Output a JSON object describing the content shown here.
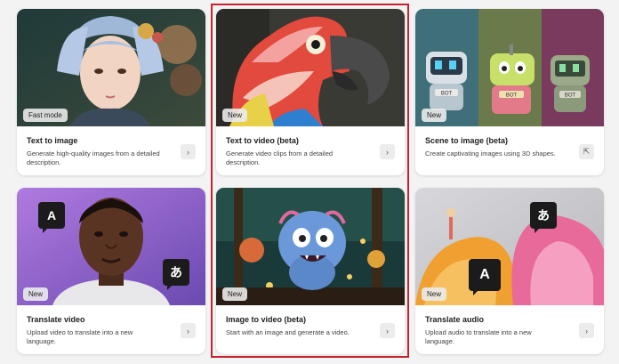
{
  "cards": [
    {
      "title": "Text to image",
      "desc": "Generate high-quality images from a detailed description.",
      "badge": "Fast mode",
      "icon": "chevron-right-icon"
    },
    {
      "title": "Text to video (beta)",
      "desc": "Generate video clips from a detailed description.",
      "badge": "New",
      "icon": "chevron-right-icon"
    },
    {
      "title": "Scene to image (beta)",
      "desc": "Create captivating images using 3D shapes.",
      "badge": "New",
      "icon": "external-link-icon"
    },
    {
      "title": "Translate video",
      "desc": "Upload video to translate into a new language.",
      "badge": "New",
      "icon": "chevron-right-icon",
      "tags": [
        "A",
        "あ"
      ]
    },
    {
      "title": "Image to video (beta)",
      "desc": "Start with an image and generate a video.",
      "badge": "New",
      "icon": "chevron-right-icon"
    },
    {
      "title": "Translate audio",
      "desc": "Upload audio to translate into a new language.",
      "badge": "New",
      "icon": "chevron-right-icon",
      "tags": [
        "A",
        "あ"
      ]
    }
  ],
  "robot_labels": [
    "BOT",
    "BOT",
    "BOT"
  ],
  "glyphs": {
    "chevron": "›",
    "external": "⇱"
  },
  "colors": {
    "highlight": "#c8232c"
  }
}
